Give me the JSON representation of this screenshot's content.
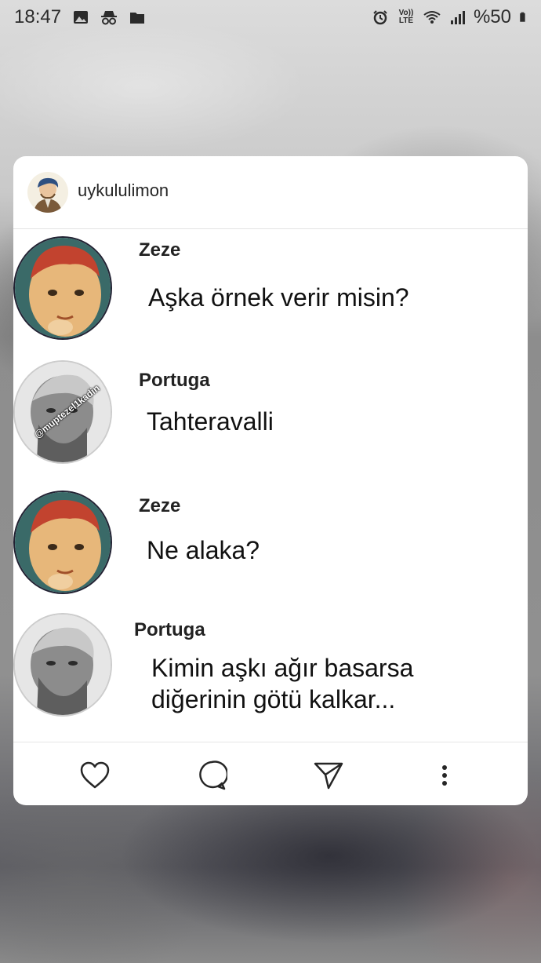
{
  "status_bar": {
    "time": "18:47",
    "left_icons": [
      "image-icon",
      "incognito-icon",
      "folder-icon"
    ],
    "right_icons": [
      "alarm-icon",
      "volte-icon",
      "wifi-icon",
      "signal-icon",
      "battery-icon"
    ],
    "volte_text": "Vo)) LTE",
    "battery": "%50"
  },
  "post": {
    "username": "uykululimon",
    "watermark": "@muptezel1kadin",
    "messages": [
      {
        "name": "Zeze",
        "text": "Aşka örnek verir misin?"
      },
      {
        "name": "Portuga",
        "text": "Tahteravalli"
      },
      {
        "name": "Zeze",
        "text": "Ne alaka?"
      },
      {
        "name": "Portuga",
        "text": "Kimin aşkı ağır basarsa diğerinin götü kalkar..."
      }
    ],
    "actions": [
      "heart-icon",
      "comment-icon",
      "share-icon",
      "more-icon"
    ]
  },
  "colors": {
    "card_background": "#ffffff",
    "text": "#262626",
    "icon": "#262626"
  }
}
